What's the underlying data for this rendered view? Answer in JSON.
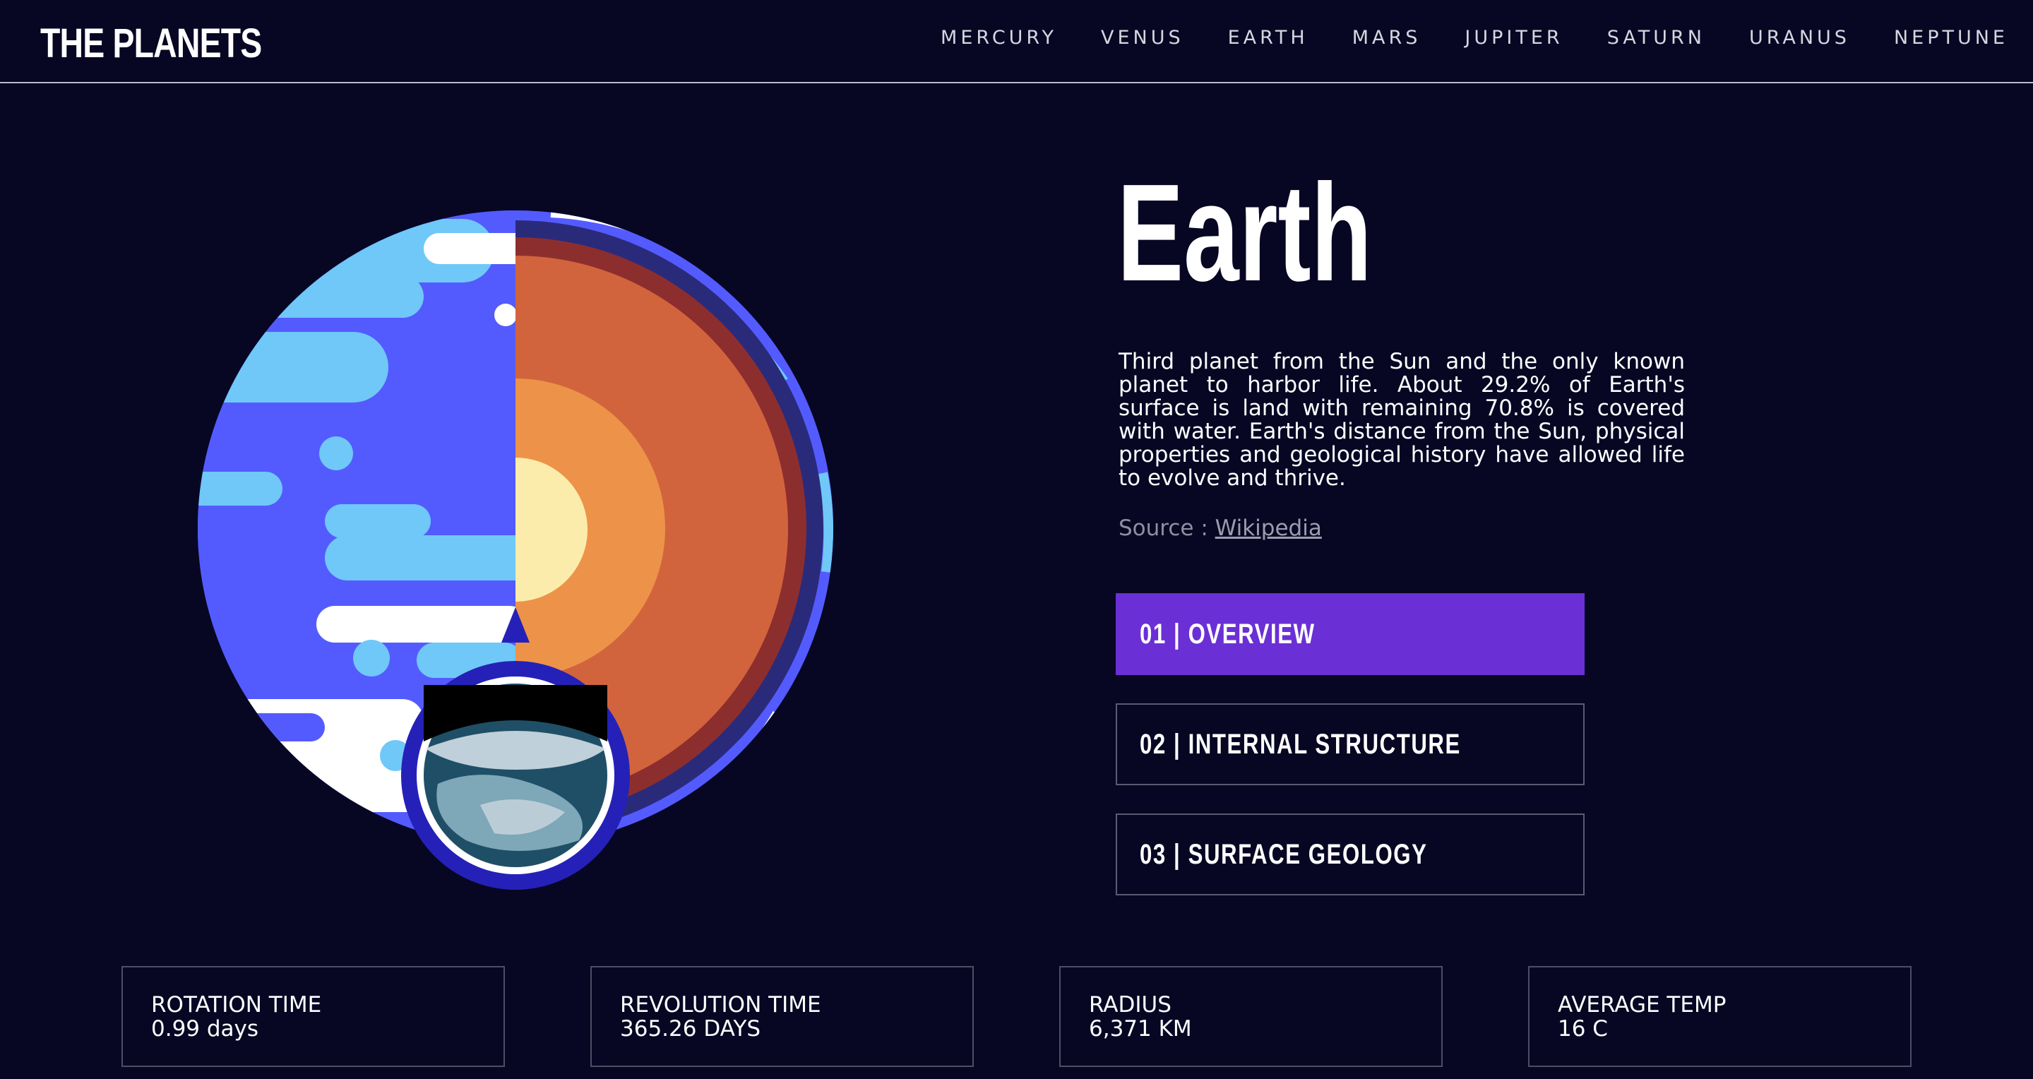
{
  "header": {
    "logo": "THE PLANETS",
    "nav": [
      "MERCURY",
      "VENUS",
      "EARTH",
      "MARS",
      "JUPITER",
      "SATURN",
      "URANUS",
      "NEPTUNE"
    ]
  },
  "planet": {
    "name": "Earth",
    "description": "Third planet from the Sun and the only known planet to harbor life. About 29.2% of Earth's surface is land with remaining 70.8% is covered with water. Earth's distance from the Sun, physical properties and geological history have allowed life to evolve and thrive.",
    "source_prefix": "Source : ",
    "source_link": "Wikipedia"
  },
  "tabs": [
    {
      "label": "01 | OVERVIEW",
      "active": true
    },
    {
      "label": "02 | INTERNAL STRUCTURE",
      "active": false
    },
    {
      "label": "03 | SURFACE GEOLOGY",
      "active": false
    }
  ],
  "stats": [
    {
      "label": "ROTATION TIME",
      "value": "0.99 days"
    },
    {
      "label": "REVOLUTION TIME",
      "value": "365.26 DAYS"
    },
    {
      "label": "RADIUS",
      "value": "6,371 KM"
    },
    {
      "label": "AVERAGE TEMP",
      "value": "16 C"
    }
  ],
  "colors": {
    "background": "#070724",
    "active_tab": "#6b2fd6",
    "ocean": "#545bfe",
    "land_light": "#6fc8f8",
    "core_inner": "#fcecab",
    "core_outer": "#ec9349",
    "mantle": "#d2643d",
    "crust": "#8d2e2e"
  }
}
